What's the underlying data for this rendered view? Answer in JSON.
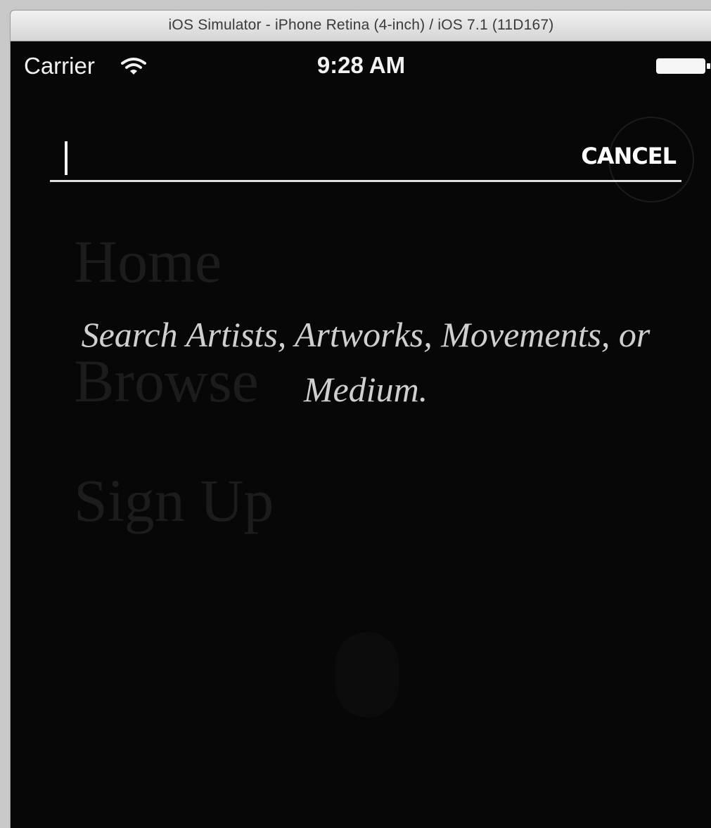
{
  "window": {
    "title": "iOS Simulator - iPhone Retina (4-inch) / iOS 7.1 (11D167)"
  },
  "statusbar": {
    "carrier": "Carrier",
    "time": "9:28 AM",
    "wifi_icon": "wifi-icon",
    "battery_icon": "battery-icon"
  },
  "search": {
    "value": "",
    "placeholder": "",
    "cancel_label": "CANCEL"
  },
  "menu": {
    "items": [
      {
        "label": "Home"
      },
      {
        "label": "Browse"
      },
      {
        "label": "Sign Up"
      }
    ]
  },
  "hint": {
    "text": "Search Artists, Artworks, Movements, or Medium."
  },
  "colors": {
    "background": "#070707",
    "text": "#f2f2f2",
    "menu_dim": "#1c1c1c",
    "hint": "#cfcfcf"
  }
}
